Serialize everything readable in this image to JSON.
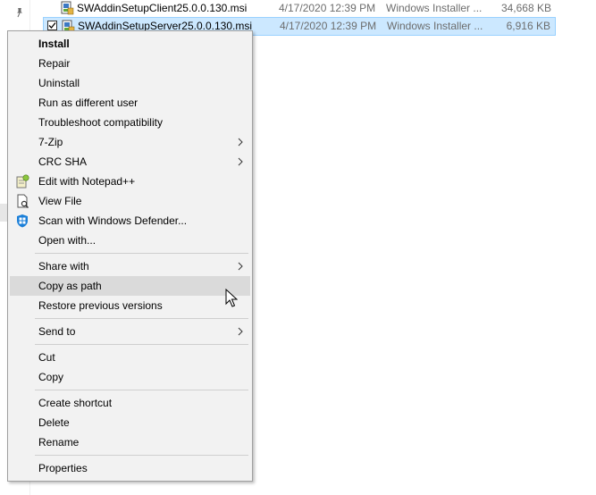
{
  "files": [
    {
      "name": "SWAddinSetupClient25.0.0.130.msi",
      "date": "4/17/2020 12:39 PM",
      "type": "Windows Installer ...",
      "size": "34,668 KB",
      "selected": false,
      "icon": "msi-installer-icon"
    },
    {
      "name": "SWAddinSetupServer25.0.0.130.msi",
      "date": "4/17/2020 12:39 PM",
      "type": "Windows Installer ...",
      "size": "6,916 KB",
      "selected": true,
      "icon": "msi-installer-icon"
    }
  ],
  "menu": {
    "items": [
      {
        "label": "Install",
        "bold": true
      },
      {
        "label": "Repair"
      },
      {
        "label": "Uninstall"
      },
      {
        "label": "Run as different user"
      },
      {
        "label": "Troubleshoot compatibility"
      },
      {
        "label": "7-Zip",
        "submenu": true
      },
      {
        "label": "CRC SHA",
        "submenu": true
      },
      {
        "label": "Edit with Notepad++",
        "icon": "notepad-plus-plus-icon"
      },
      {
        "label": "View File",
        "icon": "view-file-icon"
      },
      {
        "label": "Scan with Windows Defender...",
        "icon": "windows-defender-icon"
      },
      {
        "label": "Open with..."
      },
      {
        "label": "Share with",
        "submenu": true
      },
      {
        "label": "Copy as path",
        "hovered": true
      },
      {
        "label": "Restore previous versions"
      },
      {
        "label": "Send to",
        "submenu": true
      },
      {
        "label": "Cut"
      },
      {
        "label": "Copy"
      },
      {
        "label": "Create shortcut"
      },
      {
        "label": "Delete"
      },
      {
        "label": "Rename"
      },
      {
        "label": "Properties"
      }
    ]
  },
  "colors": {
    "selection_bg": "#cce8ff",
    "selection_border": "#99d1ff",
    "menu_bg": "#f2f2f2",
    "menu_hover": "#dadada"
  }
}
